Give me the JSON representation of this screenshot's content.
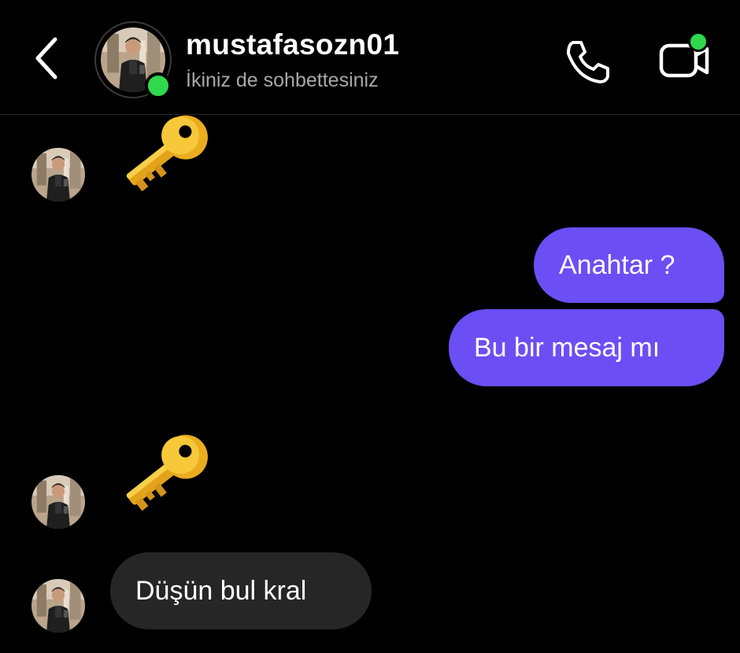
{
  "header": {
    "username": "mustafasozn01",
    "status": "İkiniz de sohbettesiniz"
  },
  "messages": [
    {
      "type": "emoji",
      "direction": "incoming",
      "icon": "key-icon"
    },
    {
      "type": "text",
      "direction": "outgoing",
      "text": "Anahtar ?"
    },
    {
      "type": "text",
      "direction": "outgoing",
      "text": "Bu bir mesaj mı"
    },
    {
      "type": "emoji",
      "direction": "incoming",
      "icon": "key-icon"
    },
    {
      "type": "text",
      "direction": "incoming",
      "text": "Düşün bul kral"
    }
  ],
  "colors": {
    "outgoing_bubble": "#6c4ef5",
    "incoming_bubble": "#262626",
    "online": "#2fd84d",
    "background": "#000000"
  }
}
